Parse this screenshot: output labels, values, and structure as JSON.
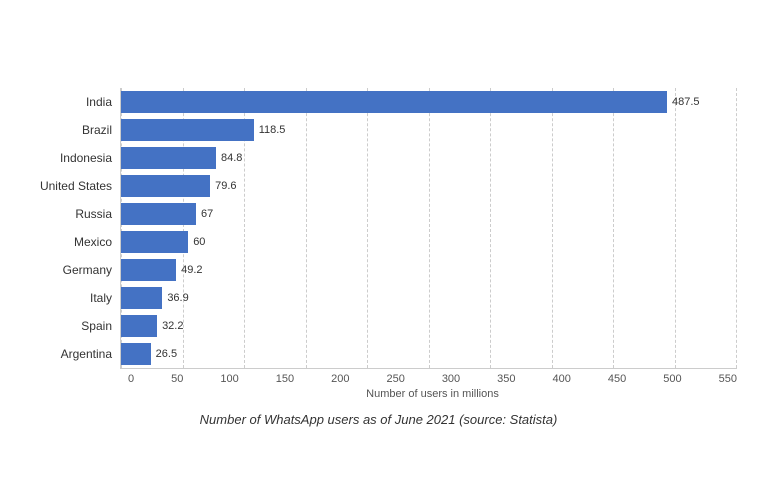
{
  "chart": {
    "title": "Number of WhatsApp users as of June 2021 (source: Statista)",
    "x_axis_label": "Number of users in millions",
    "x_ticks": [
      "0",
      "50",
      "100",
      "150",
      "200",
      "250",
      "300",
      "350",
      "400",
      "450",
      "500",
      "550"
    ],
    "max_value": 550,
    "bars": [
      {
        "country": "India",
        "value": 487.5,
        "label": "487.5"
      },
      {
        "country": "Brazil",
        "value": 118.5,
        "label": "118.5"
      },
      {
        "country": "Indonesia",
        "value": 84.8,
        "label": "84.8"
      },
      {
        "country": "United States",
        "value": 79.6,
        "label": "79.6"
      },
      {
        "country": "Russia",
        "value": 67,
        "label": "67"
      },
      {
        "country": "Mexico",
        "value": 60,
        "label": "60"
      },
      {
        "country": "Germany",
        "value": 49.2,
        "label": "49.2"
      },
      {
        "country": "Italy",
        "value": 36.9,
        "label": "36.9"
      },
      {
        "country": "Spain",
        "value": 32.2,
        "label": "32.2"
      },
      {
        "country": "Argentina",
        "value": 26.5,
        "label": "26.5"
      }
    ]
  }
}
